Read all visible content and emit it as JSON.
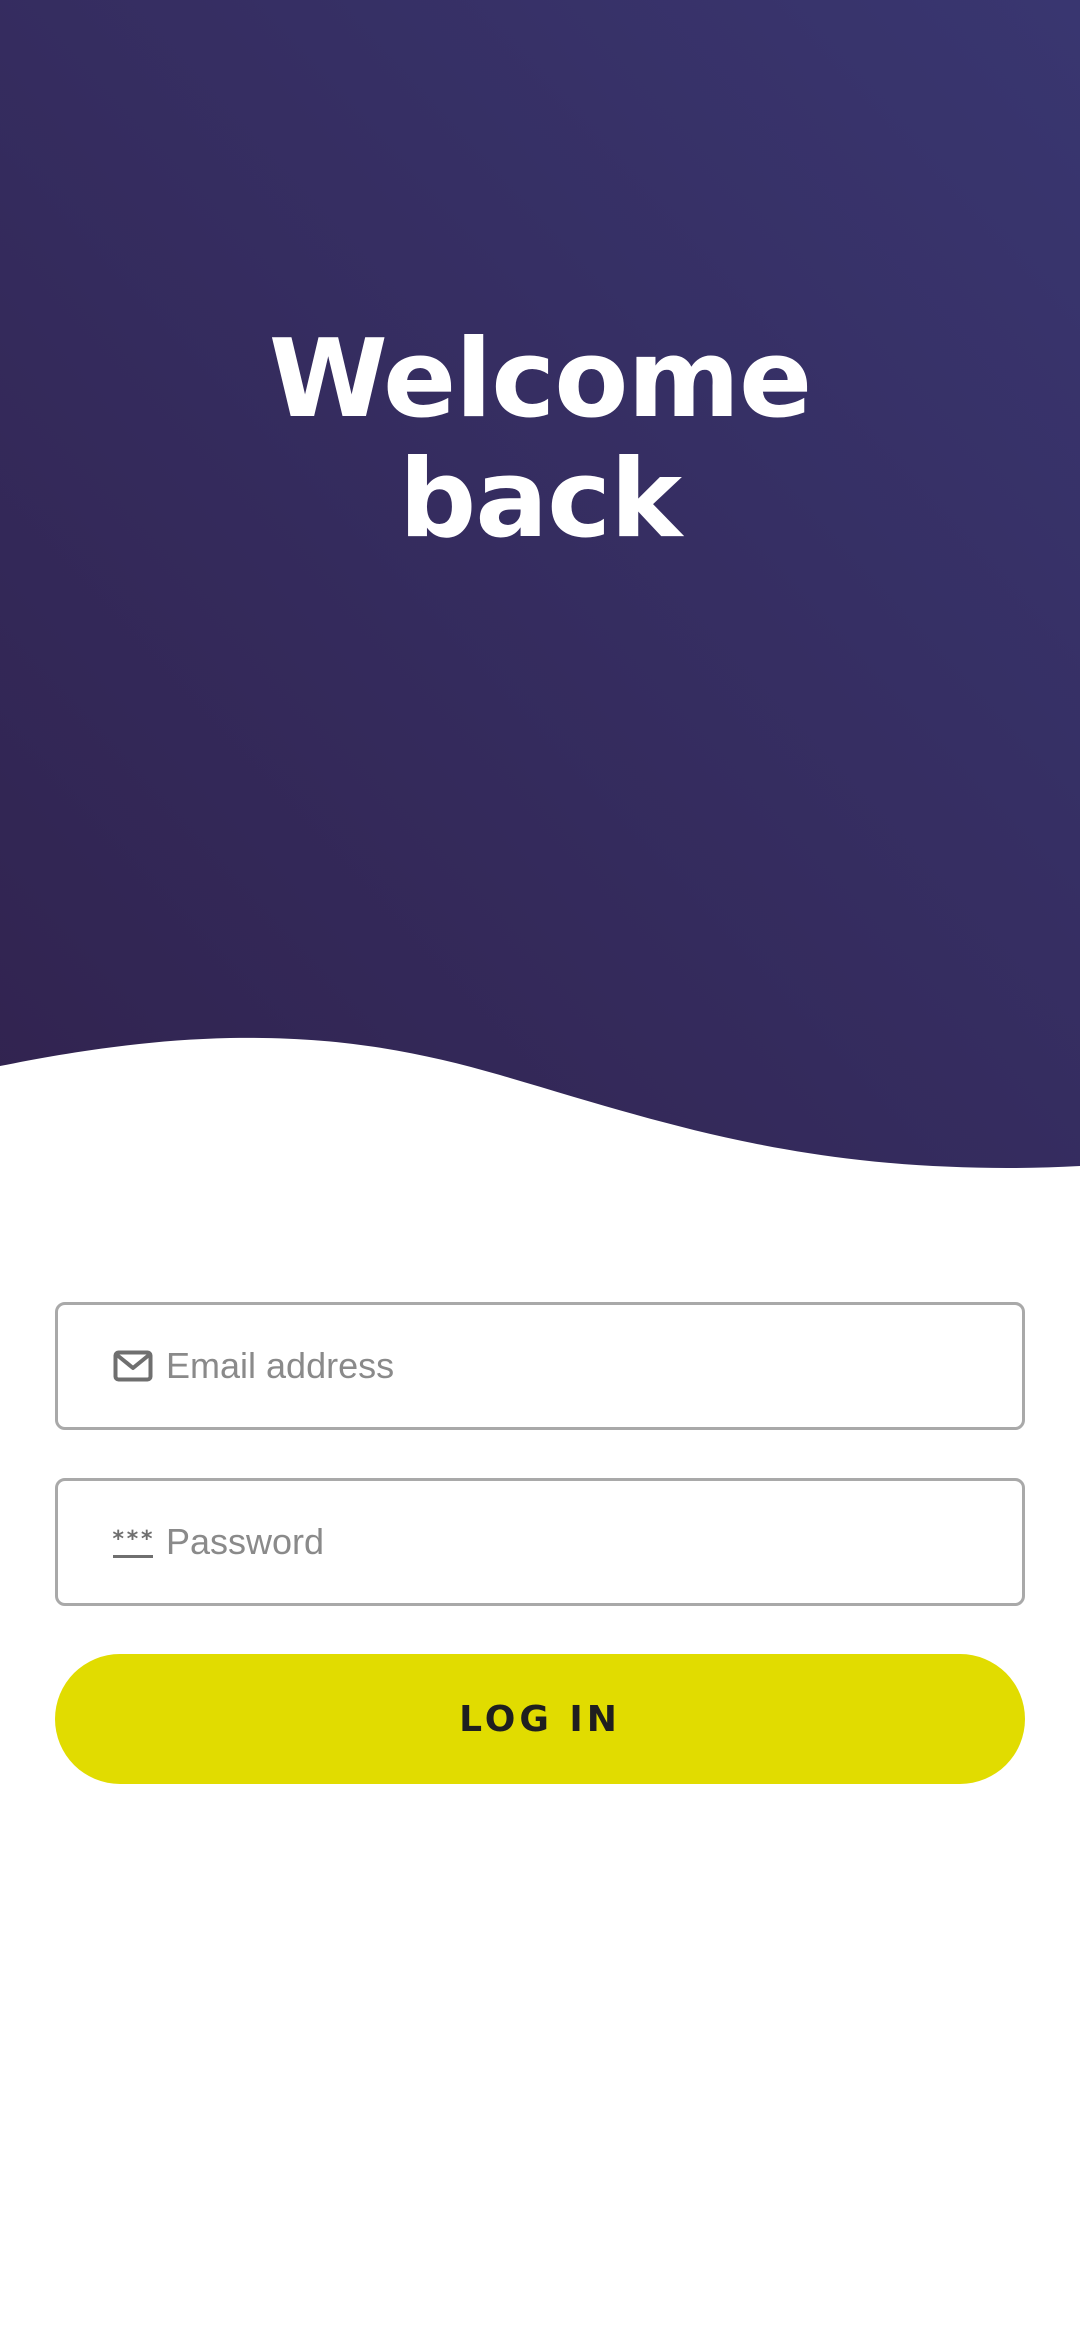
{
  "hero": {
    "title_line_1": "Welcome",
    "title_line_2": "back"
  },
  "form": {
    "email": {
      "placeholder": "Email address",
      "value": "",
      "icon": "mail-icon"
    },
    "password": {
      "placeholder": "Password",
      "value": "",
      "icon": "password-icon",
      "icon_glyph": "***"
    },
    "login_button": {
      "label": "LOG IN"
    }
  },
  "colors": {
    "hero_top": "#393670",
    "hero_bottom": "#32234f",
    "accent_button": "#e1dc00",
    "field_border": "#a9a9a9",
    "placeholder": "#8a8a8a"
  }
}
